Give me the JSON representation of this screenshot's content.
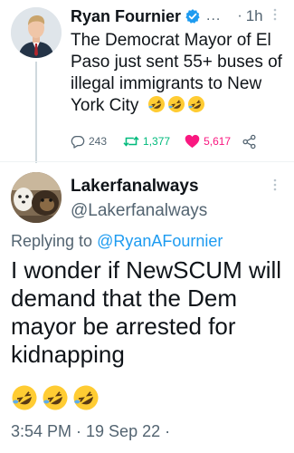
{
  "parent_tweet": {
    "author_name": "Ryan Fournier",
    "more_indicator": "...",
    "separator": "·",
    "time_ago": "1h",
    "text": "The Democrat Mayor of El Paso just sent 55+ buses of illegal immigrants to New York City",
    "emojis": [
      "🤣",
      "🤣",
      "🤣"
    ],
    "reply_count": "243",
    "retweet_count": "1,377",
    "like_count": "5,617"
  },
  "reply_tweet": {
    "author_name": "Lakerfanalways",
    "handle": "@Lakerfanalways",
    "replying_prefix": "Replying to",
    "replying_to": "@RyanAFournier",
    "text": "I wonder if NewSCUM will demand that the Dem mayor be arrested for kidnapping",
    "emojis": [
      "🤣",
      "🤣",
      "🤣"
    ],
    "timestamp": "3:54 PM · 19 Sep 22 ·"
  },
  "colors": {
    "text": "#0f1419",
    "muted": "#536471",
    "link": "#1d9bf0",
    "retweet": "#00ba7c",
    "like": "#f91880",
    "verified": "#1d9bf0"
  }
}
